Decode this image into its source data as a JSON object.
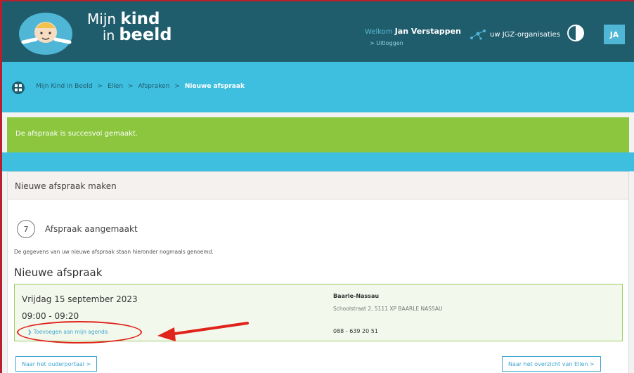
{
  "header": {
    "logo_line1_prefix": "Mijn",
    "logo_line1_bold": "kind",
    "logo_line2_prefix": "in",
    "logo_line2_bold": "beeld",
    "welcome_label": "Welkom",
    "user_name": "Jan Verstappen",
    "logout_label": "> Uitloggen",
    "jgz_label": "uw JGZ-organisaties",
    "avatar_initials": "JA"
  },
  "breadcrumb": {
    "items": [
      "Mijn Kind in Beeld",
      "Ellen",
      "Afspraken",
      "Nieuwe afspraak"
    ],
    "separator": ">"
  },
  "success_message": "De afspraak is succesvol gemaakt.",
  "panel": {
    "title": "Nieuwe afspraak maken",
    "step_number": "7",
    "step_title": "Afspraak aangemaakt",
    "intro_text": "De gegevens van uw nieuwe afspraak staan hieronder nogmaals genoemd.",
    "appointment_heading": "Nieuwe afspraak"
  },
  "appointment": {
    "date": "Vrijdag 15 september 2023",
    "time": "09:00 - 09:20",
    "add_to_agenda": "Toevoegen aan mijn agenda",
    "location_name": "Baarle-Nassau",
    "location_address": "Schoolstraat 2, 5111 XP BAARLE NASSAU",
    "phone": "088 - 639 20 51"
  },
  "buttons": {
    "parent_portal": "Naar het ouderportaal >",
    "overview": "Naar het overzicht van Ellen >"
  },
  "colors": {
    "header_bg": "#1f5c6c",
    "accent_blue": "#3fbfe0",
    "success_green": "#8cc63f",
    "annotation_red": "#e0231b"
  }
}
